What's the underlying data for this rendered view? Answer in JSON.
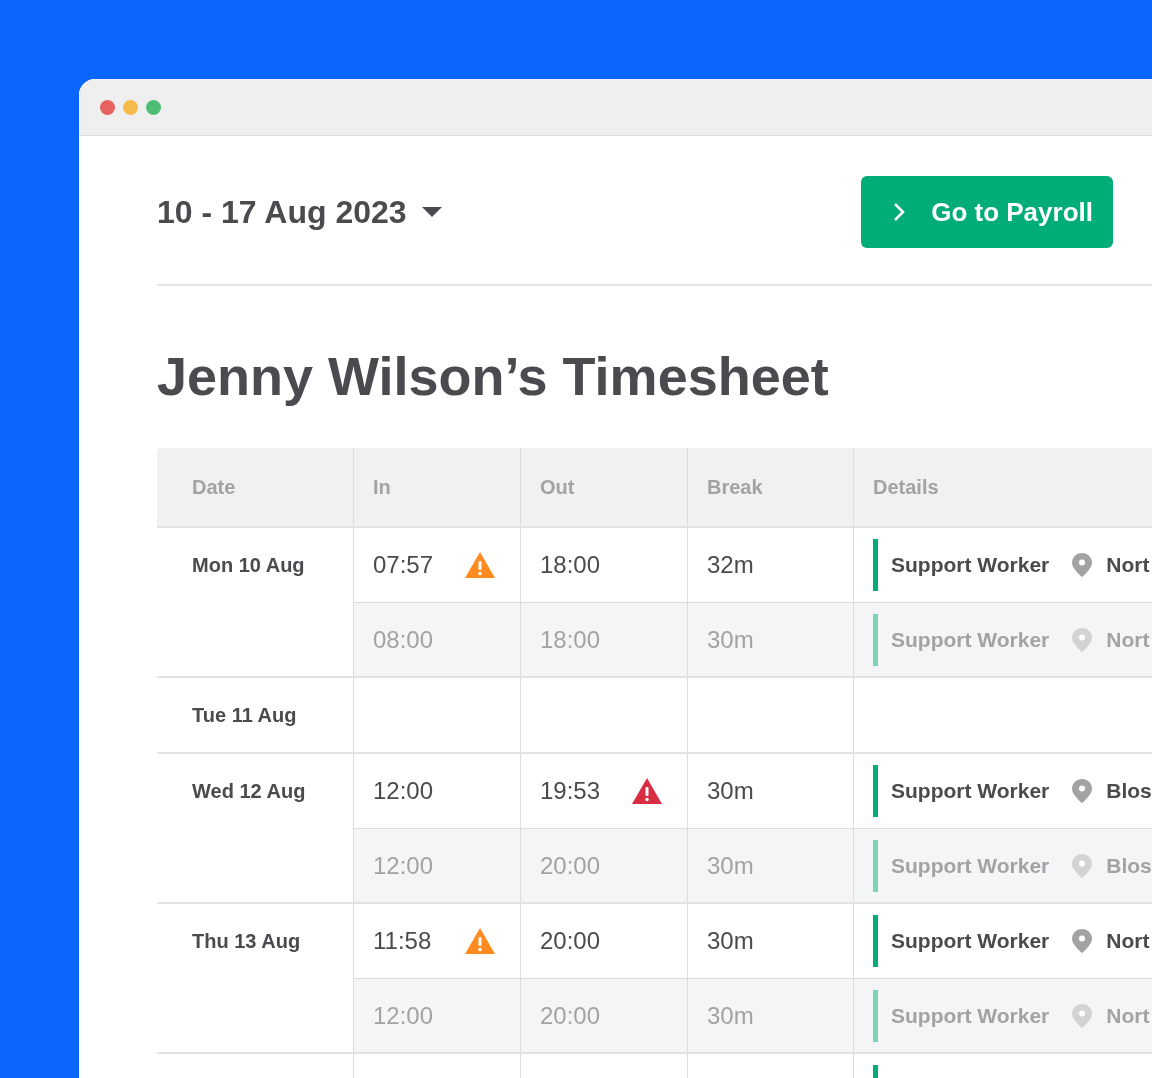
{
  "period": {
    "label": "10 - 17 Aug 2023"
  },
  "payroll_button": {
    "label": "Go to Payroll"
  },
  "title": "Jenny Wilson’s Timesheet",
  "table": {
    "columns": [
      "Date",
      "In",
      "Out",
      "Break",
      "Details"
    ],
    "days": [
      {
        "date": "Mon 10 Aug",
        "entries": [
          {
            "kind": "actual",
            "in": {
              "time": "07:57",
              "warning": {
                "color": "#ff8a1f"
              }
            },
            "out": {
              "time": "18:00"
            },
            "break": "32m",
            "role": "Support Worker",
            "location": "Nort"
          },
          {
            "kind": "scheduled",
            "in": {
              "time": "08:00"
            },
            "out": {
              "time": "18:00"
            },
            "break": "30m",
            "role": "Support Worker",
            "location": "Nort"
          }
        ]
      },
      {
        "date": "Tue 11 Aug"
      },
      {
        "date": "Wed 12 Aug",
        "entries": [
          {
            "kind": "actual",
            "in": {
              "time": "12:00"
            },
            "out": {
              "time": "19:53",
              "warning": {
                "color": "#d92d42"
              }
            },
            "break": "30m",
            "role": "Support Worker",
            "location": "Blos"
          },
          {
            "kind": "scheduled",
            "in": {
              "time": "12:00"
            },
            "out": {
              "time": "20:00"
            },
            "break": "30m",
            "role": "Support Worker",
            "location": "Blos"
          }
        ]
      },
      {
        "date": "Thu 13 Aug",
        "entries": [
          {
            "kind": "actual",
            "in": {
              "time": "11:58",
              "warning": {
                "color": "#ff8a1f"
              }
            },
            "out": {
              "time": "20:00"
            },
            "break": "30m",
            "role": "Support Worker",
            "location": "Nort"
          },
          {
            "kind": "scheduled",
            "in": {
              "time": "12:00"
            },
            "out": {
              "time": "20:00"
            },
            "break": "30m",
            "role": "Support Worker",
            "location": "Nort"
          }
        ]
      },
      {
        "entries": [
          {
            "kind": "actual"
          }
        ]
      }
    ]
  }
}
